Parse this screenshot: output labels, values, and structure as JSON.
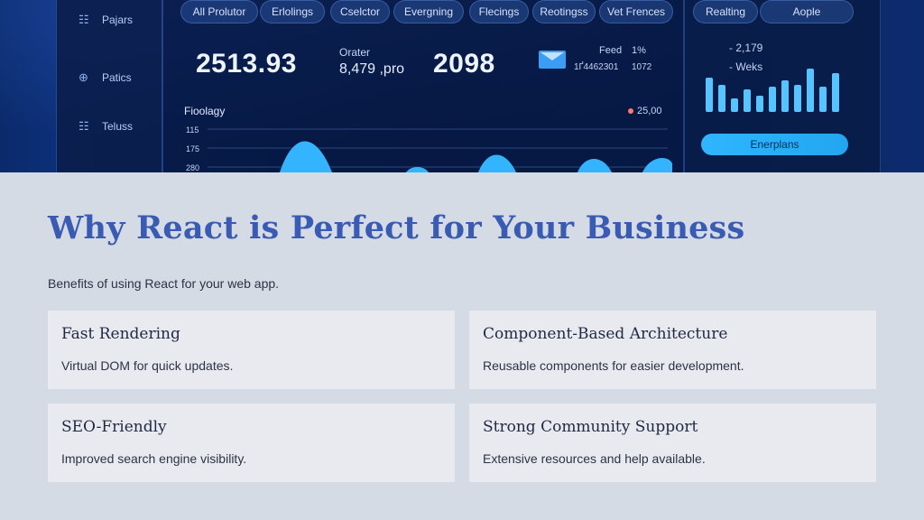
{
  "dashboard": {
    "sidebar": {
      "items": [
        {
          "label": "Pajars",
          "icon": "list-icon"
        },
        {
          "label": "Patics",
          "icon": "currency-icon"
        },
        {
          "label": "Teluss",
          "icon": "list-icon"
        }
      ]
    },
    "filters": [
      "All Prolutor",
      "Erlolings",
      "Cselctor",
      "Evergning",
      "Flecings",
      "Reotingss",
      "Vet Frences"
    ],
    "right_tabs": [
      "Realting",
      "Aople"
    ],
    "stats": {
      "stat_1": "2513.93",
      "stat_2_label": "Orater",
      "stat_2_value": "8,479 ,pro",
      "stat_3": "2098",
      "feed_label": "Feed",
      "feed_percent": "1%",
      "feed_sub_1": "1Ґ4462301",
      "feed_sub_2": "1072"
    },
    "chart": {
      "title": "Fioolagy",
      "legend_value": "25,00",
      "ticks": [
        "115",
        "175",
        "280"
      ]
    },
    "right_panel": {
      "line_1": "- 2,179",
      "line_2": "- Weks",
      "bar_levels": [
        0.75,
        0.6,
        0.3,
        0.5,
        0.35,
        0.55,
        0.7,
        0.6,
        0.95,
        0.55,
        0.85
      ],
      "button_label": "Enerplans"
    }
  },
  "section": {
    "title": "Why React is Perfect for Your Business",
    "subtitle": "Benefits of using React for your web app.",
    "cards": [
      {
        "title": "Fast Rendering",
        "description": "Virtual DOM for quick updates."
      },
      {
        "title": "Component-Based Architecture",
        "description": "Reusable components for easier development."
      },
      {
        "title": "SEO-Friendly",
        "description": "Improved search engine visibility."
      },
      {
        "title": "Strong Community Support",
        "description": "Extensive resources and help available."
      }
    ]
  },
  "colors": {
    "heading": "#3a5bb3",
    "page_bg": "#d5dbe4",
    "card_bg": "#e8eaf0",
    "dashboard_bg": "#0a2258",
    "accent": "#2fb6ff"
  }
}
